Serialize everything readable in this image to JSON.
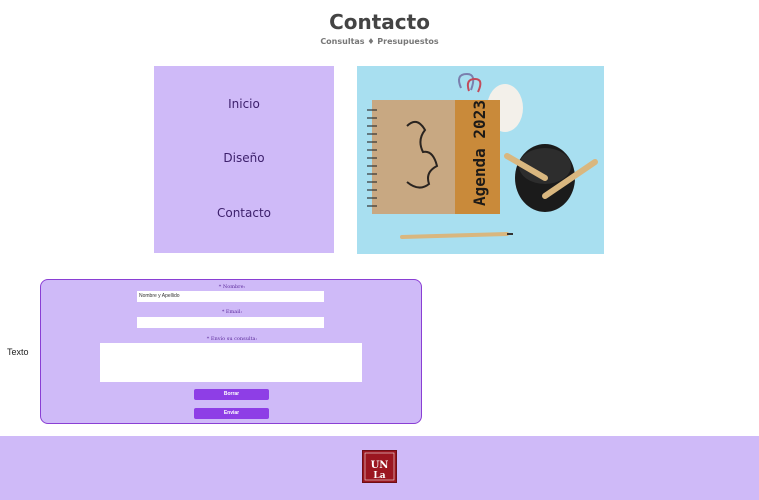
{
  "header": {
    "title": "Contacto",
    "subtitle": "Consultas ♦ Presupuestos"
  },
  "nav": {
    "items": [
      {
        "label": "Inicio"
      },
      {
        "label": "Diseño"
      },
      {
        "label": "Contacto"
      }
    ]
  },
  "hero": {
    "agenda_text": "Agenda 2023"
  },
  "side": {
    "label": "Texto"
  },
  "form": {
    "name_label": "* Nombre:",
    "name_value": "Nombre y Apellido",
    "email_label": "* Email:",
    "email_value": "",
    "message_label": "* Envío su consulta:",
    "reset_label": "Borrar",
    "submit_label": "Enviar"
  },
  "footer": {
    "logo_text": "UNLa"
  },
  "colors": {
    "panel": "#cfbaf8",
    "accent": "#8e3ee6",
    "logo": "#9b1620"
  }
}
